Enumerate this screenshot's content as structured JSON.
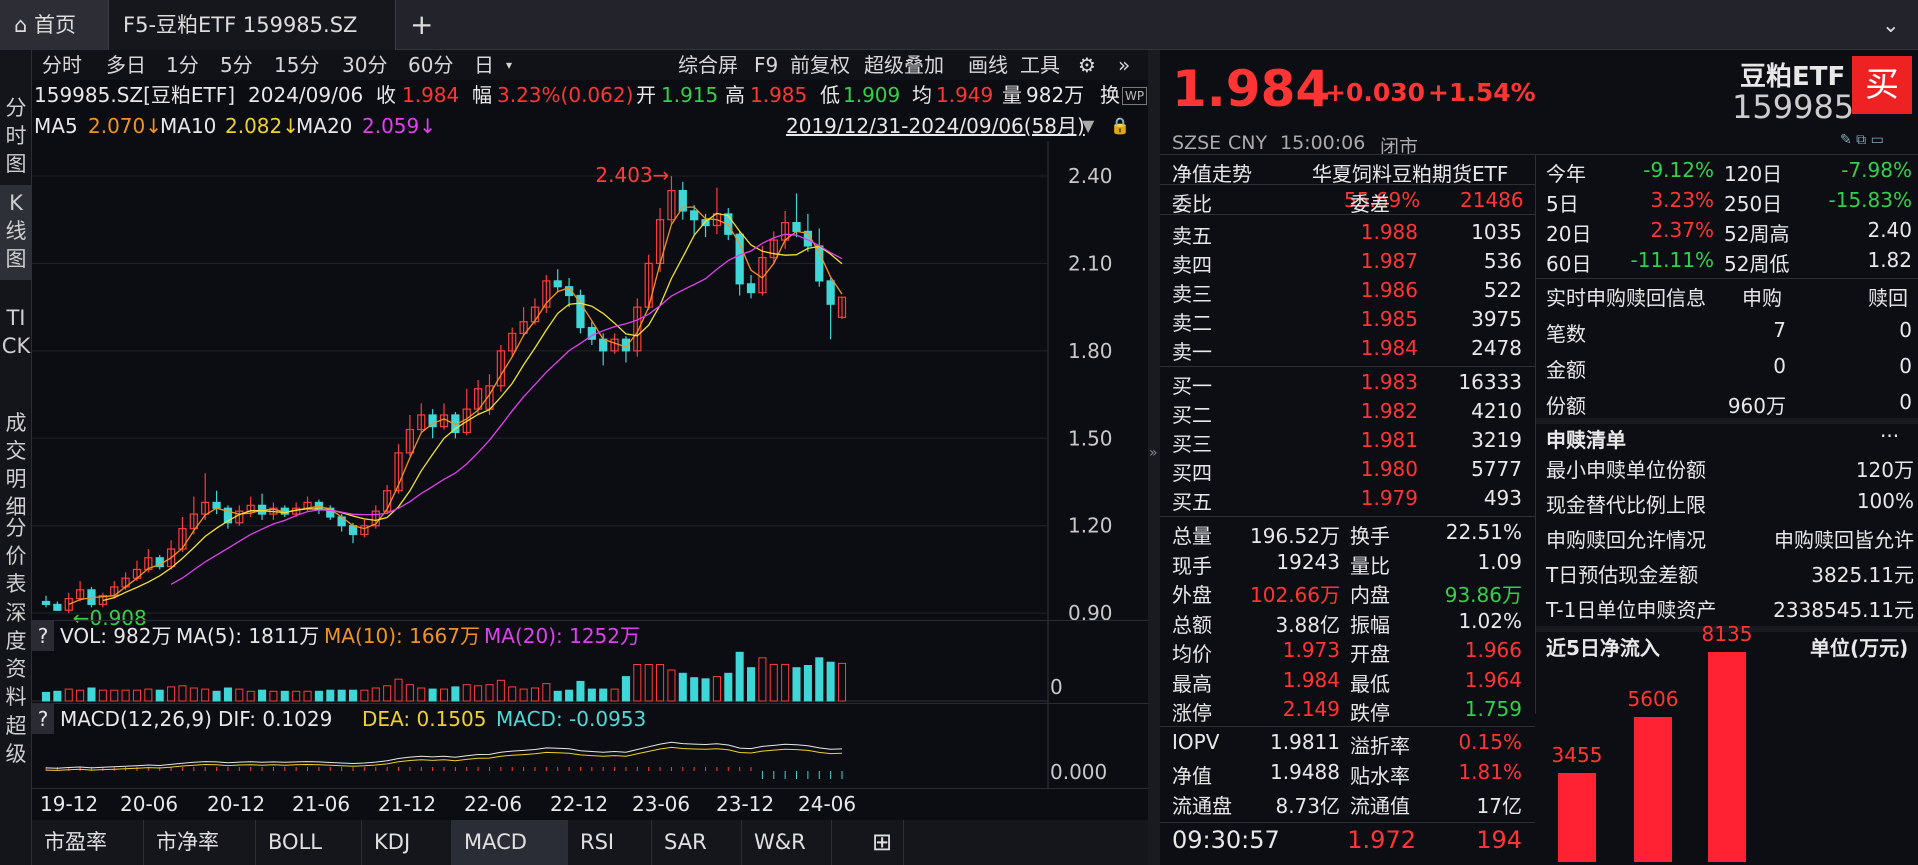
{
  "tabs": {
    "home": "首页",
    "etf": "F5-豆粕ETF 159985.SZ"
  },
  "sidebar": [
    "分时图",
    "K线图",
    "TICK",
    "成交明细",
    "分价表",
    "深度资料",
    "超级"
  ],
  "toolbar": {
    "left": [
      "分时",
      "多日",
      "1分",
      "5分",
      "15分",
      "30分",
      "60分",
      "日"
    ],
    "right": [
      "综合屏",
      "F9",
      "前复权",
      "超级叠加",
      "画线",
      "工具"
    ]
  },
  "info": {
    "code": "159985.SZ[豆粕ETF]",
    "date": "2024/09/06",
    "close_label": "收",
    "close": "1.984",
    "amp_label": "幅",
    "amp": "3.23%(0.062)",
    "open_label": "开",
    "open": "1.915",
    "high_label": "高",
    "high": "1.985",
    "low_label": "低",
    "low": "1.909",
    "avg_label": "均",
    "avg": "1.949",
    "vol_label": "量",
    "vol": "982万",
    "turn_label": "换",
    "ma5_label": "MA5",
    "ma5": "2.070↓",
    "ma10_label": "MA10",
    "ma10": "2.082↓",
    "ma20_label": "MA20",
    "ma20": "2.059↓",
    "range": "2019/12/31-2024/09/06(58月)"
  },
  "chart_data": {
    "type": "candlestick",
    "x_ticks": [
      "19-12",
      "20-06",
      "20-12",
      "21-06",
      "21-12",
      "22-06",
      "22-12",
      "23-06",
      "23-12",
      "24-06"
    ],
    "y_ticks": [
      "2.40",
      "2.10",
      "1.80",
      "1.50",
      "1.20",
      "0.90"
    ],
    "ylim": [
      0.88,
      2.52
    ],
    "annotations": {
      "max": "2.403",
      "min": "0.908"
    },
    "candles": [
      [
        0.94,
        0.93,
        0.96,
        0.92
      ],
      [
        0.93,
        0.91,
        0.94,
        0.908
      ],
      [
        0.91,
        0.95,
        0.97,
        0.9
      ],
      [
        0.95,
        0.98,
        1.01,
        0.94
      ],
      [
        0.98,
        0.93,
        0.99,
        0.92
      ],
      [
        0.93,
        0.96,
        0.97,
        0.92
      ],
      [
        0.96,
        0.99,
        1.01,
        0.95
      ],
      [
        0.99,
        1.02,
        1.04,
        0.98
      ],
      [
        1.02,
        1.05,
        1.08,
        1.01
      ],
      [
        1.05,
        1.09,
        1.12,
        1.04
      ],
      [
        1.09,
        1.06,
        1.1,
        1.05
      ],
      [
        1.06,
        1.12,
        1.15,
        1.05
      ],
      [
        1.12,
        1.19,
        1.23,
        1.11
      ],
      [
        1.19,
        1.24,
        1.3,
        1.17
      ],
      [
        1.24,
        1.28,
        1.38,
        1.22
      ],
      [
        1.28,
        1.26,
        1.32,
        1.24
      ],
      [
        1.26,
        1.21,
        1.27,
        1.19
      ],
      [
        1.21,
        1.25,
        1.27,
        1.2
      ],
      [
        1.25,
        1.27,
        1.3,
        1.23
      ],
      [
        1.27,
        1.24,
        1.31,
        1.22
      ],
      [
        1.24,
        1.26,
        1.28,
        1.22
      ],
      [
        1.26,
        1.24,
        1.27,
        1.23
      ],
      [
        1.24,
        1.26,
        1.28,
        1.23
      ],
      [
        1.26,
        1.28,
        1.3,
        1.25
      ],
      [
        1.28,
        1.26,
        1.29,
        1.24
      ],
      [
        1.26,
        1.23,
        1.27,
        1.22
      ],
      [
        1.23,
        1.2,
        1.24,
        1.18
      ],
      [
        1.2,
        1.17,
        1.21,
        1.14
      ],
      [
        1.17,
        1.2,
        1.22,
        1.16
      ],
      [
        1.2,
        1.25,
        1.27,
        1.19
      ],
      [
        1.25,
        1.32,
        1.34,
        1.24
      ],
      [
        1.32,
        1.45,
        1.48,
        1.31
      ],
      [
        1.45,
        1.53,
        1.58,
        1.44
      ],
      [
        1.53,
        1.58,
        1.62,
        1.52
      ],
      [
        1.58,
        1.54,
        1.6,
        1.5
      ],
      [
        1.54,
        1.58,
        1.62,
        1.53
      ],
      [
        1.58,
        1.52,
        1.59,
        1.5
      ],
      [
        1.52,
        1.6,
        1.67,
        1.51
      ],
      [
        1.6,
        1.67,
        1.7,
        1.58
      ],
      [
        1.6,
        1.68,
        1.72,
        1.58
      ],
      [
        1.68,
        1.8,
        1.82,
        1.66
      ],
      [
        1.8,
        1.86,
        1.88,
        1.78
      ],
      [
        1.86,
        1.9,
        1.95,
        1.85
      ],
      [
        1.9,
        1.95,
        1.98,
        1.89
      ],
      [
        1.95,
        2.04,
        2.06,
        1.93
      ],
      [
        2.04,
        2.02,
        2.08,
        2.0
      ],
      [
        2.02,
        1.99,
        2.05,
        1.95
      ],
      [
        1.99,
        1.88,
        2.01,
        1.86
      ],
      [
        1.88,
        1.84,
        1.9,
        1.82
      ],
      [
        1.84,
        1.8,
        1.86,
        1.75
      ],
      [
        1.8,
        1.84,
        1.86,
        1.79
      ],
      [
        1.84,
        1.8,
        1.85,
        1.76
      ],
      [
        1.8,
        1.95,
        1.98,
        1.78
      ],
      [
        1.95,
        2.1,
        2.13,
        1.94
      ],
      [
        2.1,
        2.25,
        2.29,
        2.07
      ],
      [
        2.25,
        2.35,
        2.4,
        2.23
      ],
      [
        2.35,
        2.28,
        2.38,
        2.25
      ],
      [
        2.28,
        2.25,
        2.3,
        2.2
      ],
      [
        2.25,
        2.23,
        2.27,
        2.19
      ],
      [
        2.23,
        2.27,
        2.36,
        2.2
      ],
      [
        2.27,
        2.2,
        2.29,
        2.18
      ],
      [
        2.2,
        2.03,
        2.21,
        1.99
      ],
      [
        2.03,
        2.0,
        2.06,
        1.98
      ],
      [
        2.0,
        2.12,
        2.16,
        1.99
      ],
      [
        2.12,
        2.18,
        2.21,
        2.1
      ],
      [
        2.18,
        2.24,
        2.28,
        2.15
      ],
      [
        2.24,
        2.21,
        2.34,
        2.19
      ],
      [
        2.21,
        2.16,
        2.27,
        2.14
      ],
      [
        2.16,
        2.04,
        2.22,
        2.02
      ],
      [
        2.04,
        1.96,
        2.05,
        1.84
      ],
      [
        1.915,
        1.984,
        1.985,
        1.909
      ]
    ]
  },
  "vol_info": {
    "q": "?",
    "vol": "VOL: 982万",
    "ma5": "MA(5): 1811万",
    "ma10": "MA(10): 1667万",
    "ma20": "MA(20): 1252万",
    "zero": "0"
  },
  "macd_info": {
    "q": "?",
    "name": "MACD(12,26,9)",
    "dif": "DIF: 0.1029",
    "dea": "DEA: 0.1505",
    "macd": "MACD: -0.0953",
    "zero": "0.000"
  },
  "bottom_tabs": [
    "市盈率",
    "市净率",
    "BOLL",
    "KDJ",
    "MACD",
    "RSI",
    "SAR",
    "W&R"
  ],
  "quote": {
    "price": "1.984",
    "change": "+0.030",
    "pct": "+1.54%",
    "name": "豆粕ETF",
    "code": "159985",
    "buy": "买",
    "exchange": "SZSE",
    "currency": "CNY",
    "time": "15:00:06",
    "status": "闭市"
  },
  "nav": {
    "label": "净值走势",
    "fund": "华夏饲料豆粕期货ETF"
  },
  "weibi": {
    "l1": "委比",
    "v1": "55.69%",
    "l2": "委差",
    "v2": "21486"
  },
  "asks": [
    [
      "卖五",
      "1.988",
      "1035"
    ],
    [
      "卖四",
      "1.987",
      "536"
    ],
    [
      "卖三",
      "1.986",
      "522"
    ],
    [
      "卖二",
      "1.985",
      "3975"
    ],
    [
      "卖一",
      "1.984",
      "2478"
    ]
  ],
  "bids": [
    [
      "买一",
      "1.983",
      "16333"
    ],
    [
      "买二",
      "1.982",
      "4210"
    ],
    [
      "买三",
      "1.981",
      "3219"
    ],
    [
      "买四",
      "1.980",
      "5777"
    ],
    [
      "买五",
      "1.979",
      "493"
    ]
  ],
  "stats": [
    [
      "总量",
      "196.52万",
      "w",
      "换手",
      "22.51%",
      "w"
    ],
    [
      "现手",
      "19243",
      "w",
      "量比",
      "1.09",
      "w"
    ],
    [
      "外盘",
      "102.66万",
      "r",
      "内盘",
      "93.86万",
      "g"
    ],
    [
      "总额",
      "3.88亿",
      "w",
      "振幅",
      "1.02%",
      "w"
    ],
    [
      "均价",
      "1.973",
      "r",
      "开盘",
      "1.966",
      "r"
    ],
    [
      "最高",
      "1.984",
      "r",
      "最低",
      "1.964",
      "r"
    ],
    [
      "涨停",
      "2.149",
      "r",
      "跌停",
      "1.759",
      "g"
    ]
  ],
  "stats2": [
    [
      "IOPV",
      "1.9811",
      "w",
      "溢折率",
      "0.15%",
      "r"
    ],
    [
      "净值",
      "1.9488",
      "w",
      "贴水率",
      "1.81%",
      "r"
    ],
    [
      "流通盘",
      "8.73亿",
      "w",
      "流通值",
      "17亿",
      "w"
    ]
  ],
  "tick": {
    "time": "09:30:57",
    "price": "1.972",
    "vol": "194"
  },
  "perf": [
    [
      "今年",
      "-9.12%",
      "g",
      "120日",
      "-7.98%",
      "g"
    ],
    [
      "5日",
      "3.23%",
      "r",
      "250日",
      "-15.83%",
      "g"
    ],
    [
      "20日",
      "2.37%",
      "r",
      "52周高",
      "2.40",
      "w"
    ],
    [
      "60日",
      "-11.11%",
      "g",
      "52周低",
      "1.82",
      "w"
    ]
  ],
  "sub": {
    "title": "实时申购赎回信息",
    "h1": "申购",
    "h2": "赎回",
    "rows": [
      [
        "笔数",
        "7",
        "0"
      ],
      [
        "金额",
        "0",
        "0"
      ],
      [
        "份额",
        "960万",
        "0"
      ]
    ]
  },
  "list": {
    "title": "申赎清单",
    "more": "···",
    "rows": [
      [
        "最小申赎单位份额",
        "120万"
      ],
      [
        "现金替代比例上限",
        "100%"
      ],
      [
        "申购赎回允许情况",
        "申购赎回皆允许"
      ],
      [
        "T日预估现金差额",
        "3825.11元"
      ],
      [
        "T-1日单位申赎资产",
        "2338545.11元"
      ]
    ]
  },
  "flow": {
    "title": "近5日净流入",
    "unit": "单位(万元)",
    "values": [
      3455,
      5606,
      8135
    ],
    "labels": [
      "3455",
      "5606",
      "8135"
    ]
  }
}
